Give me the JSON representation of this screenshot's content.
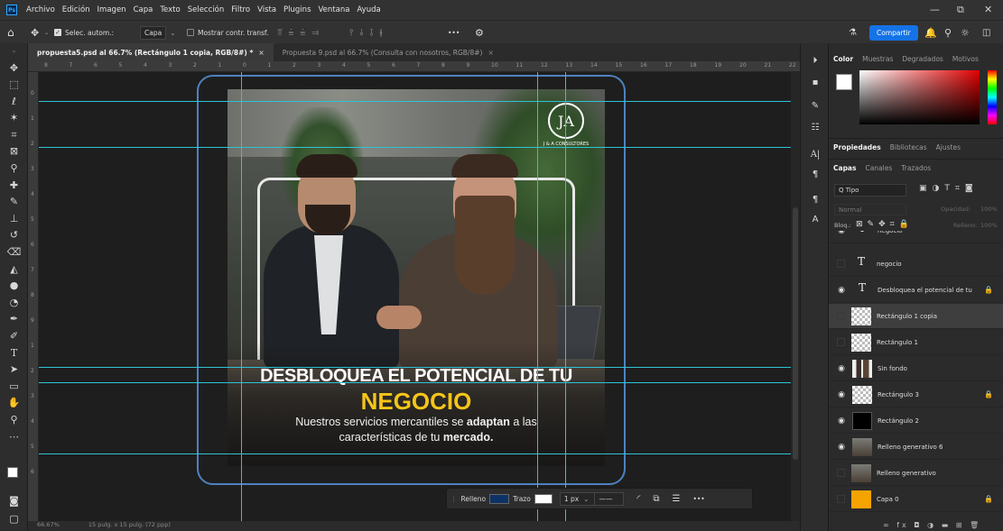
{
  "menu": {
    "app_badge": "Ps",
    "items": [
      "Archivo",
      "Edición",
      "Imagen",
      "Capa",
      "Texto",
      "Selección",
      "Filtro",
      "Vista",
      "Plugins",
      "Ventana",
      "Ayuda"
    ]
  },
  "window": {
    "minimize": "—",
    "restore": "⧉",
    "close": "✕"
  },
  "options": {
    "auto_select_label": "Selec. autom.:",
    "auto_select_target": "Capa",
    "transform_label": "Mostrar contr. transf.",
    "more": "•••",
    "share_button": "Compartir"
  },
  "tabs": [
    {
      "label": "propuesta5.psd al 66.7% (Rectángulo 1 copia, RGB/8#) *",
      "close": "×"
    },
    {
      "label": "Propuesta 9.psd al 66.7% (Consulta con nosotros, RGB/8#)",
      "close": "×"
    }
  ],
  "ruler": {
    "top_ticks": [
      "8",
      "7",
      "6",
      "5",
      "4",
      "3",
      "2",
      "1",
      "0",
      "1",
      "2",
      "3",
      "4",
      "5",
      "6",
      "7",
      "8",
      "9",
      "10",
      "11",
      "12",
      "13",
      "14",
      "15",
      "16",
      "17",
      "18",
      "19",
      "20",
      "21",
      "22"
    ],
    "left_ticks": [
      "0",
      "1",
      "2",
      "3",
      "4",
      "5",
      "6",
      "7",
      "8",
      "9",
      "1",
      "2",
      "3",
      "4",
      "5",
      "6"
    ]
  },
  "artwork": {
    "logo_mark": "JA",
    "logo_caption": "J & A CONSULTORES",
    "headline": "DESBLOQUEA EL POTENCIAL DE TU",
    "highlight": "NEGOCIO",
    "body_line1_a": "Nuestros servicios mercantiles se ",
    "body_line1_b": "adaptan",
    "body_line1_c": "  a las",
    "body_line2_a": "características de tu ",
    "body_line2_b": "mercado."
  },
  "context_bar": {
    "fill_label": "Relleno",
    "stroke_label": "Trazo",
    "stroke_size": "1 px",
    "more": "•••"
  },
  "panels": {
    "color_tabs": [
      "Color",
      "Muestras",
      "Degradados",
      "Motivos"
    ],
    "props_tabs": [
      "Propiedades",
      "Bibliotecas",
      "Ajustes"
    ],
    "layer_tabs": [
      "Capas",
      "Canales",
      "Trazados"
    ],
    "filter_label": "Q Tipo",
    "blend_mode": "Normal",
    "opacity_label": "Opacidad:",
    "opacity_value": "100%",
    "lock_label": "Bloq.:",
    "fill_label": "Relleno:",
    "fill_value": "100%",
    "layers": [
      {
        "name": "negocio",
        "kind": "text",
        "visible": true,
        "locked": false,
        "selected": false
      },
      {
        "name": "negocio",
        "kind": "text",
        "visible": false,
        "locked": false,
        "selected": false
      },
      {
        "name": "Desbloquea el potencial de tu",
        "kind": "text",
        "visible": true,
        "locked": true,
        "selected": false
      },
      {
        "name": "Rectángulo 1 copia",
        "kind": "shape-transparent",
        "visible": false,
        "locked": false,
        "selected": true
      },
      {
        "name": "Rectángulo 1",
        "kind": "shape-transparent",
        "visible": false,
        "locked": false,
        "selected": false
      },
      {
        "name": "Sin fondo",
        "kind": "photo",
        "visible": true,
        "locked": false,
        "selected": false
      },
      {
        "name": "Rectángulo 3",
        "kind": "shape-transparent",
        "visible": true,
        "locked": true,
        "selected": false
      },
      {
        "name": "Rectángulo 2",
        "kind": "shape-dark",
        "visible": true,
        "locked": false,
        "selected": false
      },
      {
        "name": "Relleno generativo 6",
        "kind": "photo",
        "visible": true,
        "locked": false,
        "selected": false
      },
      {
        "name": "Relleno generativo",
        "kind": "photo",
        "visible": false,
        "locked": false,
        "selected": false
      },
      {
        "name": "Capa 0",
        "kind": "orange",
        "visible": false,
        "locked": true,
        "selected": false
      }
    ],
    "layer_footer": "∞  fx  ◘  ◑  ▬  ⊞  🗑"
  },
  "status": {
    "zoom": "66.67%",
    "doc": "15 pulg. x 15 pulg. (72 ppp)"
  },
  "colors": {
    "accent": "#1473e6",
    "guide": "#2ec4d4",
    "artboard_frame": "#4d82c0",
    "highlight_yellow": "#f5c518",
    "orange": "#f5a300"
  }
}
